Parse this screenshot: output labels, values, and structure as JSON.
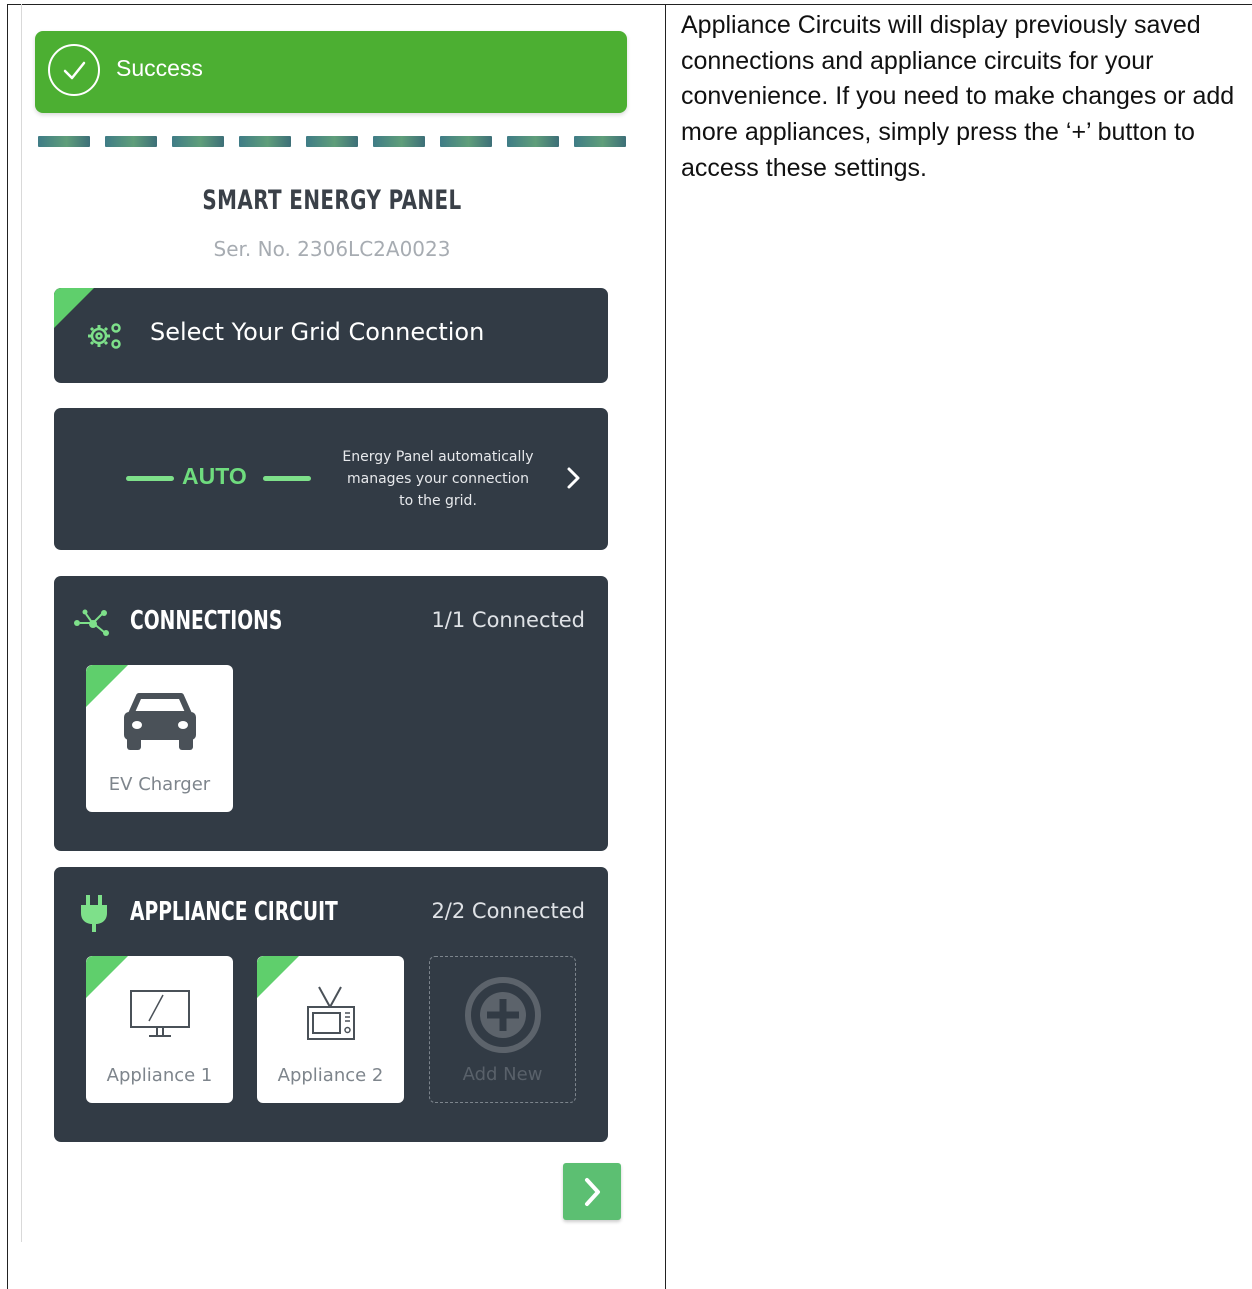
{
  "description": "Appliance Circuits will display previously saved connections and appliance circuits for your convenience. If you need to make changes or add more appliances, simply press the ‘+’ button to access these settings.",
  "toast": {
    "text": "Success",
    "color": "#4caf32"
  },
  "header": {
    "title": "SMART ENERGY PANEL",
    "serial": "Ser. No. 2306LC2A0023"
  },
  "grid": {
    "label": "Select Your Grid Connection",
    "icon": "gears-icon"
  },
  "auto": {
    "mode": "AUTO",
    "description": "Energy Panel automatically manages your connection to the grid.",
    "desc_lines": [
      "Energy Panel automatically",
      "manages your connection",
      "to the grid."
    ]
  },
  "connections": {
    "title": "CONNECTIONS",
    "count": "1/1 Connected",
    "items": [
      {
        "label": "EV Charger",
        "icon": "car-icon"
      }
    ]
  },
  "appliance_circuit": {
    "title": "APPLIANCE CIRCUIT",
    "count": "2/2 Connected",
    "items": [
      {
        "label": "Appliance 1",
        "icon": "monitor-icon"
      },
      {
        "label": "Appliance 2",
        "icon": "tv-icon"
      }
    ],
    "add_label": "Add New"
  },
  "colors": {
    "card": "#323b45",
    "accent": "#5fcf6c",
    "next_button": "#5cbf72"
  }
}
